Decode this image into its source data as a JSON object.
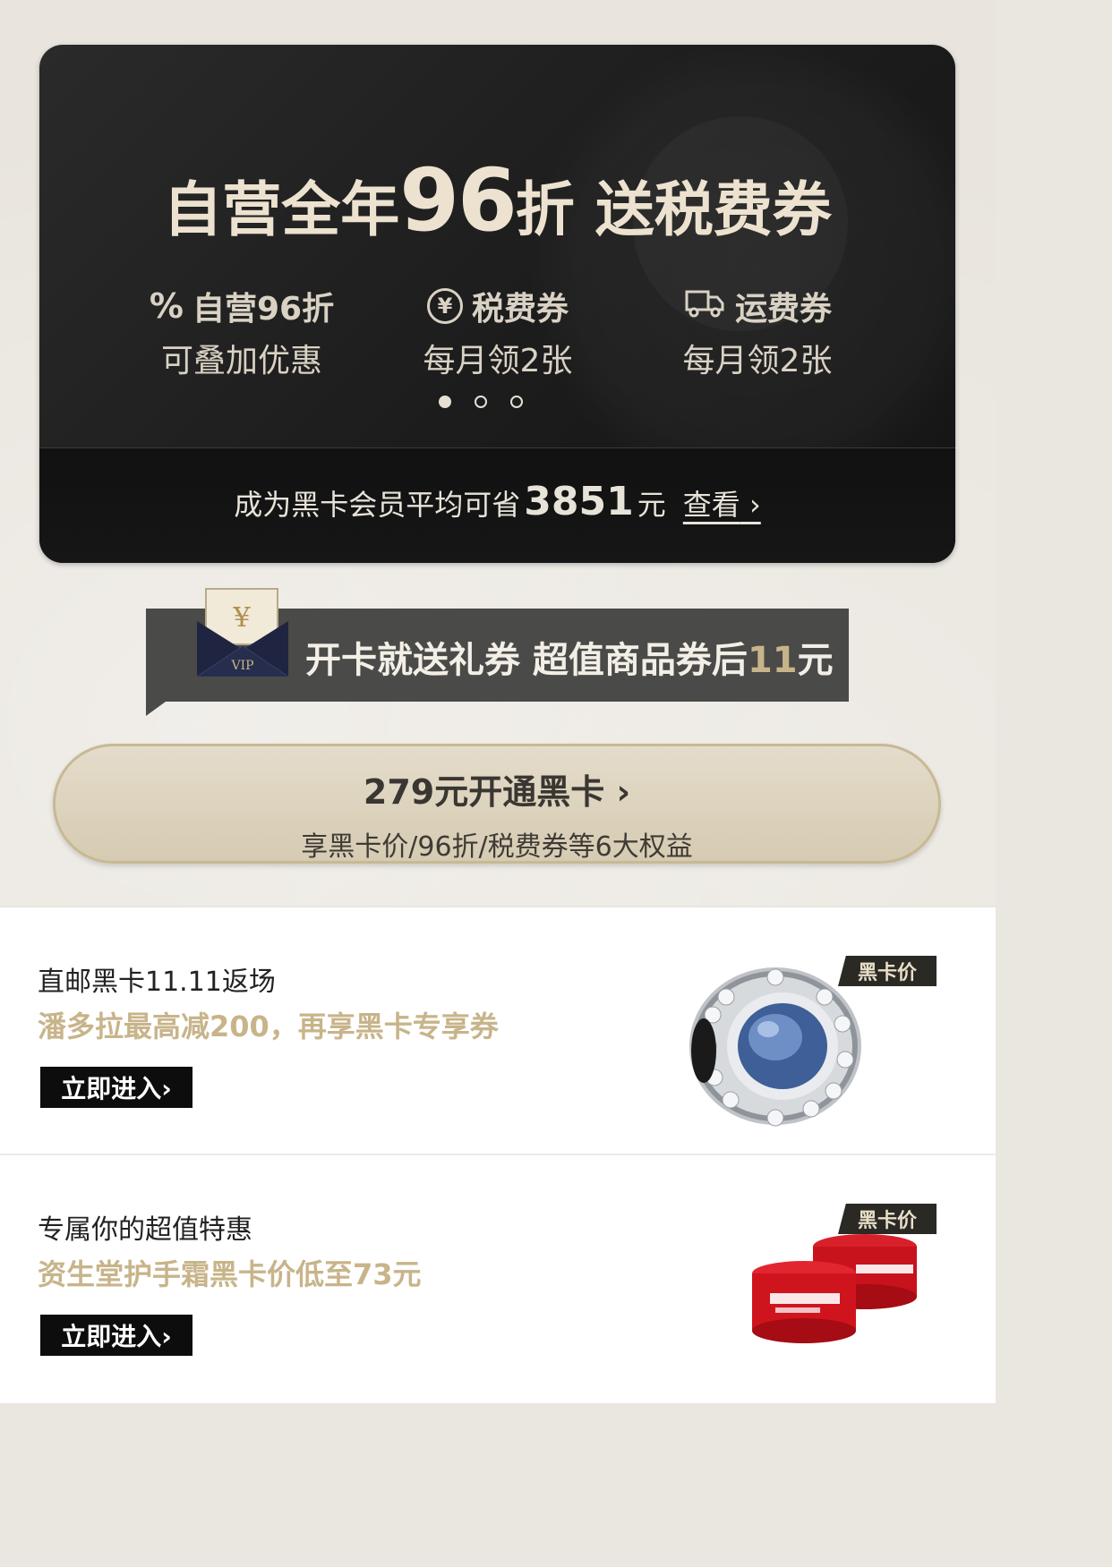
{
  "card": {
    "headline_part1": "自营全年",
    "headline_big": "96",
    "headline_part2": "折  送税费券",
    "benefits": [
      {
        "icon": "percent-icon",
        "line1": "自营96折",
        "line2": "可叠加优惠"
      },
      {
        "icon": "yen-coin-icon",
        "line1": "税费券",
        "line2": "每月领2张"
      },
      {
        "icon": "truck-icon",
        "line1": "运费券",
        "line2": "每月领2张"
      }
    ],
    "carousel_active_index": 0,
    "carousel_count": 3,
    "saving_prefix": "成为黑卡会员平均可省",
    "saving_amount": "3851",
    "saving_unit": "元",
    "view_label": "查看",
    "view_arrow": "›"
  },
  "gift": {
    "text_main": "开卡就送礼券 超值商品券后",
    "text_highlight": "11",
    "text_unit": "元",
    "envelope_symbol": "¥",
    "envelope_label": "VIP"
  },
  "open_button": {
    "line1": "279元开通黑卡 ›",
    "line2": "享黑卡价/96折/税费券等6大权益"
  },
  "promos": [
    {
      "title": "直邮黑卡11.11返场",
      "subtitle": "潘多拉最高减200，再享黑卡专享券",
      "button": "立即进入›",
      "tag": "黑卡价",
      "image": "pandora-charm"
    },
    {
      "title": "专属你的超值特惠",
      "subtitle": "资生堂护手霜黑卡价低至73元",
      "button": "立即进入›",
      "tag": "黑卡价",
      "image": "shiseido-hand-cream"
    }
  ],
  "colors": {
    "gold": "#c8b48a",
    "card_dark": "#1c1c1c",
    "banner_gray": "#4a4a48"
  }
}
